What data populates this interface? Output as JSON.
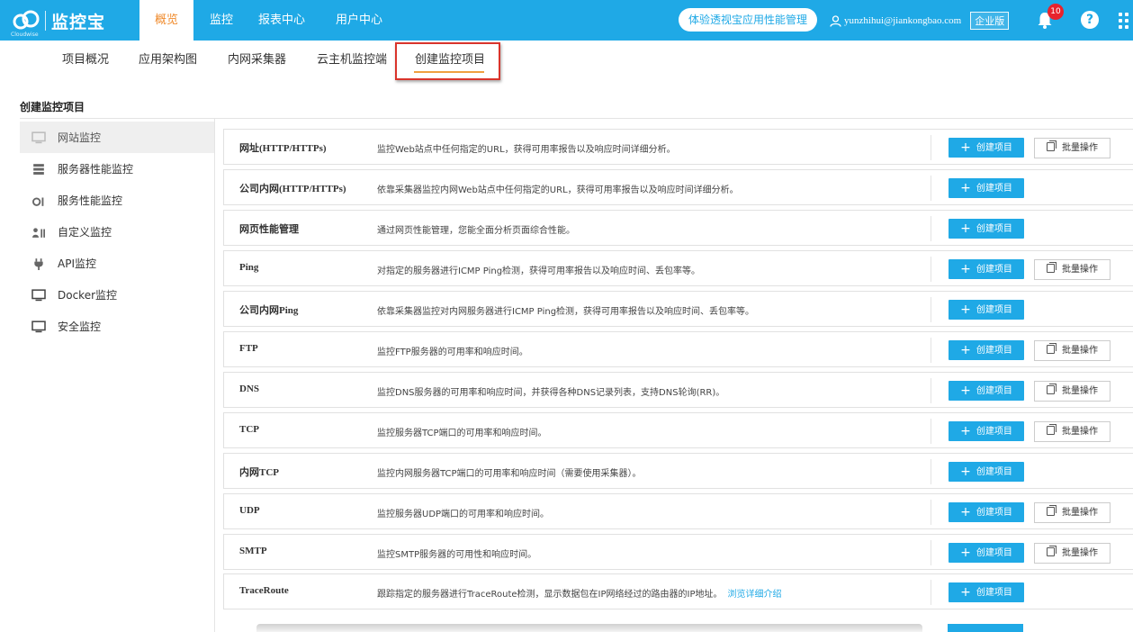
{
  "brand": {
    "logo_text": "监控宝",
    "logo_sub": "Cloudwise"
  },
  "top_nav": {
    "items": [
      {
        "label": "概览",
        "active": true
      },
      {
        "label": "监控"
      },
      {
        "label": "报表中心"
      },
      {
        "label": "用户中心"
      }
    ],
    "trial_button": "体验透视宝应用性能管理",
    "user_email": "yunzhihui@jiankongbao.com",
    "edition": "企业版",
    "notification_count": "10",
    "help": "?"
  },
  "sub_nav": {
    "items": [
      "项目概况",
      "应用架构图",
      "内网采集器",
      "云主机监控端",
      "创建监控项目"
    ]
  },
  "section": {
    "title": "创建监控项目"
  },
  "sidebar": {
    "items": [
      {
        "label": "网站监控",
        "icon": "monitor-icon",
        "active": true
      },
      {
        "label": "服务器性能监控",
        "icon": "server-icon"
      },
      {
        "label": "服务性能监控",
        "icon": "service-icon"
      },
      {
        "label": "自定义监控",
        "icon": "custom-icon"
      },
      {
        "label": "API监控",
        "icon": "plug-icon"
      },
      {
        "label": "Docker监控",
        "icon": "monitor-icon"
      },
      {
        "label": "安全监控",
        "icon": "monitor-icon"
      }
    ]
  },
  "buttons": {
    "create": "创建项目",
    "batch": "批量操作"
  },
  "monitors": [
    {
      "name": "网址(HTTP/HTTPs)",
      "desc": "监控Web站点中任何指定的URL，获得可用率报告以及响应时间详细分析。",
      "batch": true
    },
    {
      "name": "公司内网(HTTP/HTTPs)",
      "desc": "依靠采集器监控内网Web站点中任何指定的URL，获得可用率报告以及响应时间详细分析。",
      "batch": false
    },
    {
      "name": "网页性能管理",
      "desc": "通过网页性能管理，您能全面分析页面综合性能。",
      "batch": false
    },
    {
      "name": "Ping",
      "desc": "对指定的服务器进行ICMP Ping检测，获得可用率报告以及响应时间、丢包率等。",
      "batch": true
    },
    {
      "name": "公司内网Ping",
      "desc": "依靠采集器监控对内网服务器进行ICMP Ping检测，获得可用率报告以及响应时间、丢包率等。",
      "batch": false
    },
    {
      "name": "FTP",
      "desc": "监控FTP服务器的可用率和响应时间。",
      "batch": true
    },
    {
      "name": "DNS",
      "desc": "监控DNS服务器的可用率和响应时间，并获得各种DNS记录列表，支持DNS轮询(RR)。",
      "batch": true
    },
    {
      "name": "TCP",
      "desc": "监控服务器TCP端口的可用率和响应时间。",
      "batch": true
    },
    {
      "name": "内网TCP",
      "desc": "监控内网服务器TCP端口的可用率和响应时间（需要使用采集器）。",
      "batch": false
    },
    {
      "name": "UDP",
      "desc": "监控服务器UDP端口的可用率和响应时间。",
      "batch": true
    },
    {
      "name": "SMTP",
      "desc": "监控SMTP服务器的可用性和响应时间。",
      "batch": true
    },
    {
      "name": "TraceRoute",
      "desc": "跟踪指定的服务器进行TraceRoute检测，显示数据包在IP网络经过的路由器的IP地址。",
      "link": "浏览详细介绍",
      "batch": false
    }
  ],
  "colors": {
    "primary": "#1fa9e6",
    "active_nav": "#f08c2e",
    "highlight_border": "#d9342b",
    "badge": "#e8232d"
  }
}
